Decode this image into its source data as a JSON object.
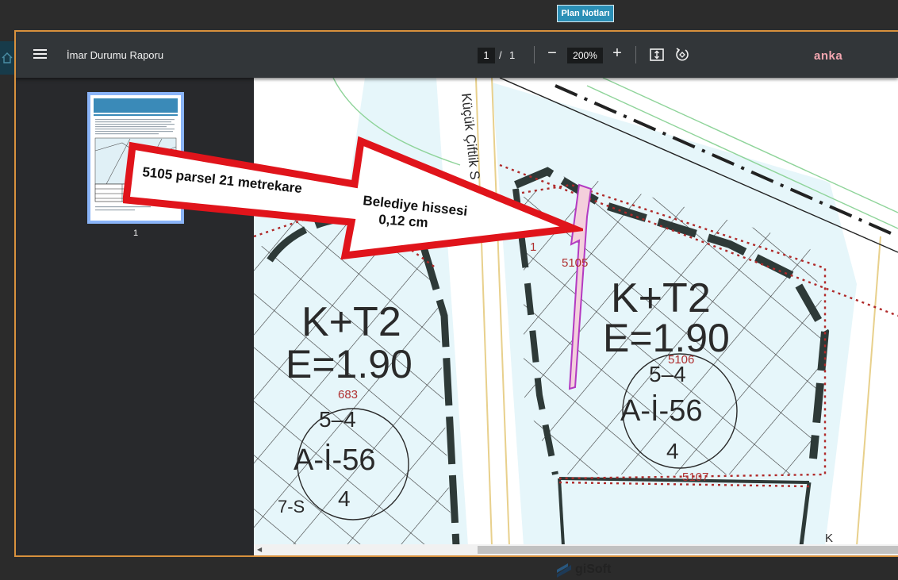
{
  "top": {
    "plan_notes_label": "Plan Notları"
  },
  "toolbar": {
    "title": "İmar Durumu Raporu",
    "page_current": "1",
    "page_separator": "/",
    "page_total": "1",
    "zoom_out_symbol": "−",
    "zoom_level": "200%",
    "zoom_in_symbol": "+",
    "brand": "anka"
  },
  "sidebar": {
    "thumbnail_label": "1"
  },
  "map": {
    "street_name": "Küçük Çiftlik S",
    "zone_left_type": "K+T2",
    "zone_left_e": "E=1.90",
    "zone_right_type": "K+T2",
    "zone_right_e": "E=1.90",
    "parcel_683": "683",
    "parcel_5105": "5105",
    "parcel_5106": "5106",
    "parcel_5107": "5107",
    "parcel_1": "1",
    "left_circle_top": "5–4",
    "left_circle_mid": "A-İ-56",
    "left_circle_bottom": "4",
    "right_circle_top": "5–4",
    "right_circle_mid": "A-İ-56",
    "right_circle_bottom": "4",
    "corner_k": "K",
    "bottom_s": "7-S"
  },
  "annotation": {
    "line1": "5105 parsel 21 metrekare",
    "line2": "Belediye hissesi",
    "line3": "0,12  cm"
  },
  "footer": {
    "logo_text": "giSoft"
  },
  "icons": {
    "menu": "hamburger-menu-icon",
    "home": "home-icon",
    "fit": "fit-to-page-icon",
    "rotate": "rotate-icon"
  }
}
